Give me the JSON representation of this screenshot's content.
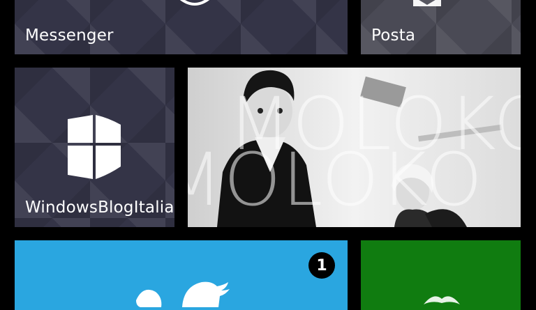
{
  "tiles": {
    "messenger": {
      "label": "Messenger"
    },
    "mail": {
      "label": "Posta"
    },
    "blog": {
      "label": "WindowsBlogItalia"
    },
    "photo": {
      "overlay_text_1": "MOLOKO",
      "overlay_text_2": "MOLOKO"
    },
    "twitter": {
      "badge": "1"
    },
    "xbox": {}
  },
  "colors": {
    "dark_tile": "#343447",
    "twitter_blue": "#2aa6e0",
    "xbox_green": "#107c10",
    "background": "#000000"
  }
}
